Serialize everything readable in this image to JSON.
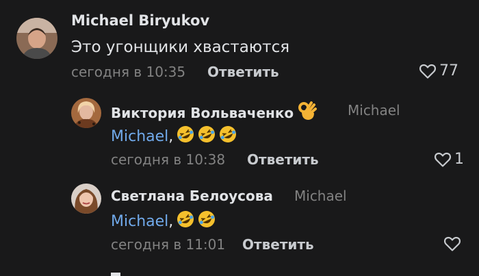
{
  "comments": [
    {
      "author": "Michael Biryukov",
      "text": "Это угонщики хвастаются",
      "time": "сегодня в 10:35",
      "reply_label": "Ответить",
      "likes": "77"
    },
    {
      "author": "Виктория Вольваченко",
      "reply_to": "Michael",
      "mention": "Michael",
      "after_mention": ",",
      "time": "сегодня в 10:38",
      "reply_label": "Ответить",
      "likes": "1"
    },
    {
      "author": "Светлана Белоусова",
      "reply_to": "Michael",
      "mention": "Michael",
      "after_mention": ",",
      "time": "сегодня в 11:01",
      "reply_label": "Ответить",
      "likes": ""
    }
  ],
  "icons": {
    "like": "heart-outline-icon",
    "reaction": "rolling-on-floor-laughing-emoji",
    "ok_hand": "ok-hand-emoji"
  },
  "colors": {
    "background": "#19191a",
    "mention": "#71aaeb",
    "muted": "#828282"
  }
}
